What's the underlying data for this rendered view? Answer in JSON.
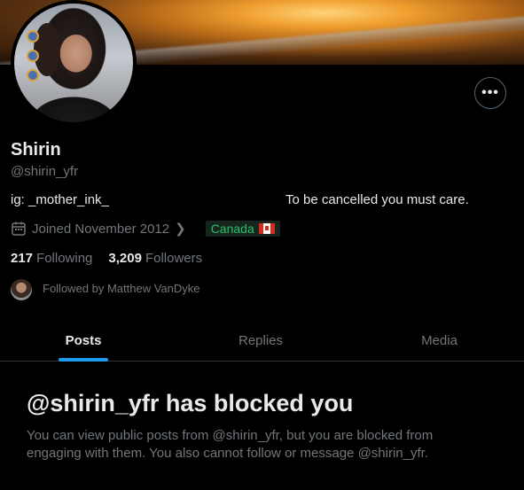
{
  "profile": {
    "name": "Shirin",
    "handle": "@shirin_yfr",
    "bio_left": "ig: _mother_ink_",
    "bio_right": "To be cancelled you must care.",
    "joined": "Joined November 2012",
    "location": "Canada",
    "following_count": "217",
    "following_label": "Following",
    "followers_count": "3,209",
    "followers_label": "Followers",
    "followed_by": "Followed by Matthew VanDyke"
  },
  "icons": {
    "more": "more-horizontal-icon",
    "calendar": "calendar-icon",
    "chevron": "chevron-right-icon",
    "flag": "canada-flag-icon"
  },
  "tabs": [
    {
      "label": "Posts",
      "active": true
    },
    {
      "label": "Replies",
      "active": false
    },
    {
      "label": "Media",
      "active": false
    }
  ],
  "blocked": {
    "title": "@shirin_yfr has blocked you",
    "message": "You can view public posts from @shirin_yfr, but you are blocked from engaging with them. You also cannot follow or message @shirin_yfr."
  },
  "colors": {
    "accent": "#1d9bf0",
    "location_text": "#27c06a",
    "muted": "#71767b",
    "background": "#000000"
  }
}
